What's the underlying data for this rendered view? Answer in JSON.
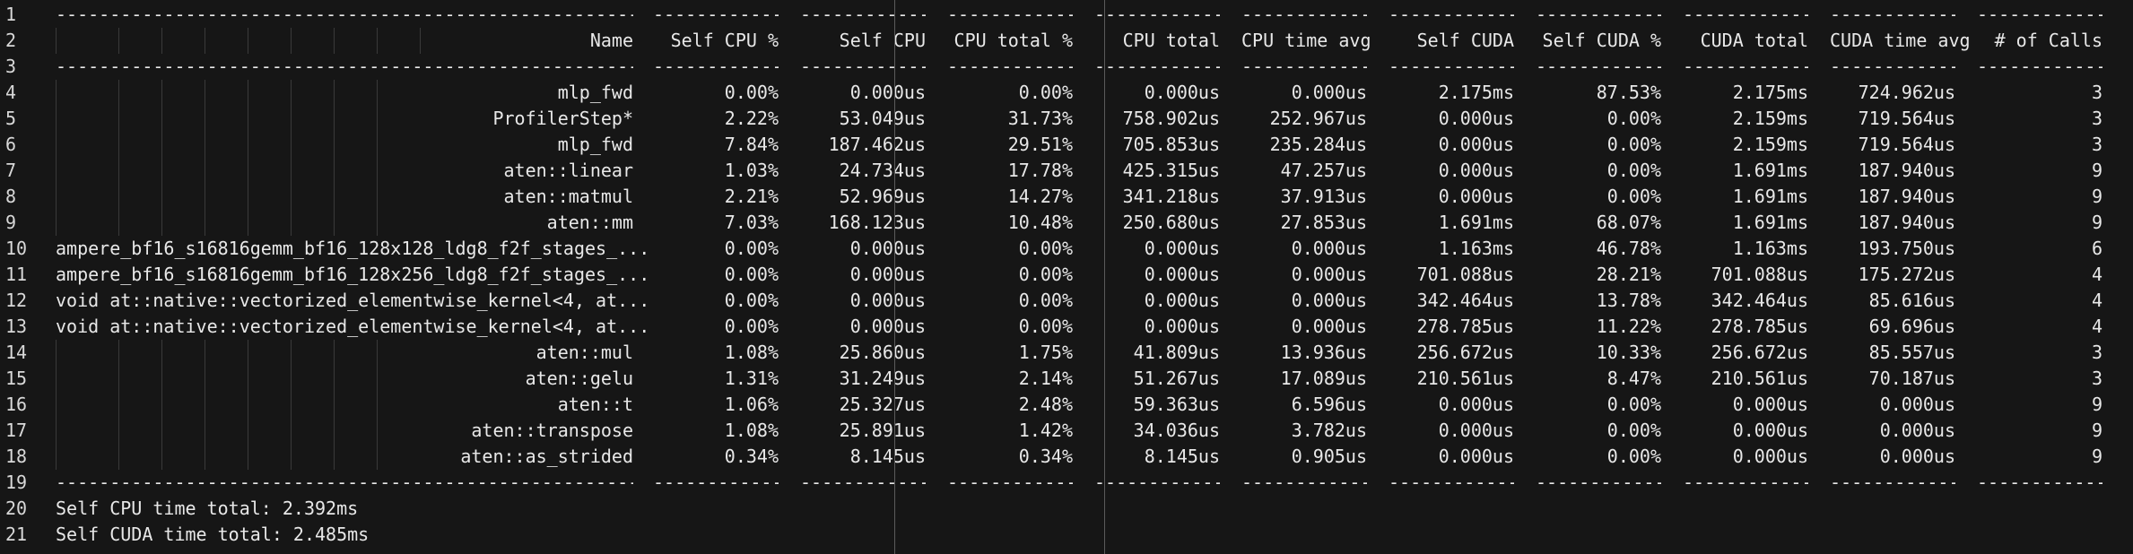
{
  "table": {
    "headers": [
      "Name",
      "Self CPU %",
      "Self CPU",
      "CPU total %",
      "CPU total",
      "CPU time avg",
      "Self CUDA",
      "Self CUDA %",
      "CUDA total",
      "CUDA time avg",
      "# of Calls"
    ],
    "rows": [
      [
        "mlp_fwd",
        "0.00%",
        "0.000us",
        "0.00%",
        "0.000us",
        "0.000us",
        "2.175ms",
        "87.53%",
        "2.175ms",
        "724.962us",
        "3"
      ],
      [
        "ProfilerStep*",
        "2.22%",
        "53.049us",
        "31.73%",
        "758.902us",
        "252.967us",
        "0.000us",
        "0.00%",
        "2.159ms",
        "719.564us",
        "3"
      ],
      [
        "mlp_fwd",
        "7.84%",
        "187.462us",
        "29.51%",
        "705.853us",
        "235.284us",
        "0.000us",
        "0.00%",
        "2.159ms",
        "719.564us",
        "3"
      ],
      [
        "aten::linear",
        "1.03%",
        "24.734us",
        "17.78%",
        "425.315us",
        "47.257us",
        "0.000us",
        "0.00%",
        "1.691ms",
        "187.940us",
        "9"
      ],
      [
        "aten::matmul",
        "2.21%",
        "52.969us",
        "14.27%",
        "341.218us",
        "37.913us",
        "0.000us",
        "0.00%",
        "1.691ms",
        "187.940us",
        "9"
      ],
      [
        "aten::mm",
        "7.03%",
        "168.123us",
        "10.48%",
        "250.680us",
        "27.853us",
        "1.691ms",
        "68.07%",
        "1.691ms",
        "187.940us",
        "9"
      ],
      [
        "ampere_bf16_s16816gemm_bf16_128x128_ldg8_f2f_stages_...",
        "0.00%",
        "0.000us",
        "0.00%",
        "0.000us",
        "0.000us",
        "1.163ms",
        "46.78%",
        "1.163ms",
        "193.750us",
        "6"
      ],
      [
        "ampere_bf16_s16816gemm_bf16_128x256_ldg8_f2f_stages_...",
        "0.00%",
        "0.000us",
        "0.00%",
        "0.000us",
        "0.000us",
        "701.088us",
        "28.21%",
        "701.088us",
        "175.272us",
        "4"
      ],
      [
        "void at::native::vectorized_elementwise_kernel<4, at...",
        "0.00%",
        "0.000us",
        "0.00%",
        "0.000us",
        "0.000us",
        "342.464us",
        "13.78%",
        "342.464us",
        "85.616us",
        "4"
      ],
      [
        "void at::native::vectorized_elementwise_kernel<4, at...",
        "0.00%",
        "0.000us",
        "0.00%",
        "0.000us",
        "0.000us",
        "278.785us",
        "11.22%",
        "278.785us",
        "69.696us",
        "4"
      ],
      [
        "aten::mul",
        "1.08%",
        "25.860us",
        "1.75%",
        "41.809us",
        "13.936us",
        "256.672us",
        "10.33%",
        "256.672us",
        "85.557us",
        "3"
      ],
      [
        "aten::gelu",
        "1.31%",
        "31.249us",
        "2.14%",
        "51.267us",
        "17.089us",
        "210.561us",
        "8.47%",
        "210.561us",
        "70.187us",
        "3"
      ],
      [
        "aten::t",
        "1.06%",
        "25.327us",
        "2.48%",
        "59.363us",
        "6.596us",
        "0.000us",
        "0.00%",
        "0.000us",
        "0.000us",
        "9"
      ],
      [
        "aten::transpose",
        "1.08%",
        "25.891us",
        "1.42%",
        "34.036us",
        "3.782us",
        "0.000us",
        "0.00%",
        "0.000us",
        "0.000us",
        "9"
      ],
      [
        "aten::as_strided",
        "0.34%",
        "8.145us",
        "0.34%",
        "8.145us",
        "0.905us",
        "0.000us",
        "0.00%",
        "0.000us",
        "0.000us",
        "9"
      ]
    ]
  },
  "line_numbers": [
    "1",
    "2",
    "3",
    "4",
    "5",
    "6",
    "7",
    "8",
    "9",
    "10",
    "11",
    "12",
    "13",
    "14",
    "15",
    "16",
    "17",
    "18",
    "19",
    "20",
    "21"
  ],
  "footer": {
    "self_cpu": "Self CPU time total: 2.392ms",
    "self_cuda": "Self CUDA time total: 2.485ms"
  },
  "dash_segments": {
    "name": "-------------------------------------------------------",
    "col": "------------"
  }
}
